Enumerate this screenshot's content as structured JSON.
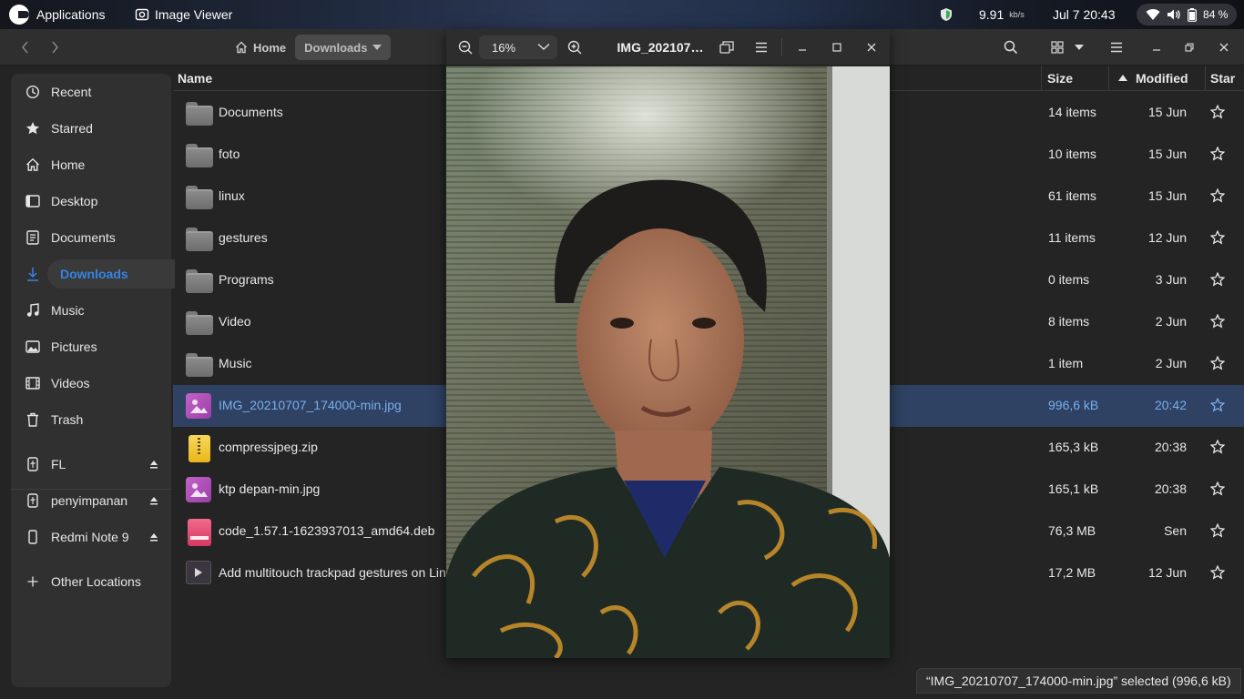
{
  "topbar": {
    "applications_label": "Applications",
    "app_title": "Image Viewer",
    "net_speed_value": "9.91",
    "net_speed_unit": "kb/s",
    "clock": "Jul 7  20:43",
    "battery": "84 %"
  },
  "file_manager": {
    "breadcrumbs": [
      {
        "label": "Home",
        "icon": "home-icon"
      },
      {
        "label": "Downloads",
        "icon": "chevron-down-icon"
      }
    ],
    "sidebar": {
      "items": [
        {
          "label": "Recent",
          "icon": "clock-icon"
        },
        {
          "label": "Starred",
          "icon": "star-icon"
        },
        {
          "label": "Home",
          "icon": "home-icon"
        },
        {
          "label": "Desktop",
          "icon": "desktop-icon"
        },
        {
          "label": "Documents",
          "icon": "document-icon"
        },
        {
          "label": "Downloads",
          "icon": "download-icon",
          "active": true
        },
        {
          "label": "Music",
          "icon": "music-icon"
        },
        {
          "label": "Pictures",
          "icon": "picture-icon"
        },
        {
          "label": "Videos",
          "icon": "video-icon"
        },
        {
          "label": "Trash",
          "icon": "trash-icon"
        }
      ],
      "devices": [
        {
          "label": "FL",
          "icon": "usb-icon"
        },
        {
          "label": "penyimpanan",
          "icon": "usb-icon"
        },
        {
          "label": "Redmi Note 9",
          "icon": "phone-icon"
        }
      ],
      "other_locations": "Other Locations"
    },
    "columns": {
      "name": "Name",
      "size": "Size",
      "modified": "Modified",
      "star": "Star"
    },
    "files": [
      {
        "name": "Documents",
        "size": "14 items",
        "modified": "15 Jun",
        "type": "folder"
      },
      {
        "name": "foto",
        "size": "10 items",
        "modified": "15 Jun",
        "type": "folder"
      },
      {
        "name": "linux",
        "size": "61 items",
        "modified": "15 Jun",
        "type": "folder"
      },
      {
        "name": "gestures",
        "size": "11 items",
        "modified": "12 Jun",
        "type": "folder"
      },
      {
        "name": "Programs",
        "size": "0 items",
        "modified": "3 Jun",
        "type": "folder"
      },
      {
        "name": "Video",
        "size": "8 items",
        "modified": "2 Jun",
        "type": "folder"
      },
      {
        "name": "Music",
        "size": "1 item",
        "modified": "2 Jun",
        "type": "folder"
      },
      {
        "name": "IMG_20210707_174000-min.jpg",
        "size": "996,6 kB",
        "modified": "20:42",
        "type": "image",
        "selected": true
      },
      {
        "name": "compressjpeg.zip",
        "size": "165,3 kB",
        "modified": "20:38",
        "type": "zip"
      },
      {
        "name": "ktp depan-min.jpg",
        "size": "165,1 kB",
        "modified": "20:38",
        "type": "image"
      },
      {
        "name": "code_1.57.1-1623937013_amd64.deb",
        "size": "76,3 MB",
        "modified": "Sen",
        "type": "deb"
      },
      {
        "name": "Add multitouch trackpad gestures on Linu",
        "size": "17,2 MB",
        "modified": "12 Jun",
        "type": "video"
      }
    ],
    "status_text": "“IMG_20210707_174000-min.jpg” selected  (996,6 kB)"
  },
  "image_viewer": {
    "zoom": "16%",
    "title": "IMG_202107…"
  },
  "colors": {
    "accent": "#3584e4",
    "selection_bg": "#2f4263",
    "window_bg": "#242424",
    "sidebar_bg": "#303030"
  }
}
